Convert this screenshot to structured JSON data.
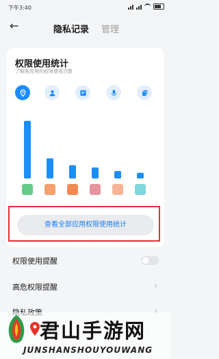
{
  "status": {
    "time": "下午3:40"
  },
  "header": {
    "back_icon": "arrow-left-icon",
    "tab_privacy": "隐私记录",
    "tab_manage": "管理"
  },
  "stats": {
    "title": "权限使用统计",
    "subtitle": "了解各应用的权限使用次数",
    "icons": [
      {
        "name": "location-icon",
        "active": true
      },
      {
        "name": "contacts-icon",
        "active": false
      },
      {
        "name": "sms-icon",
        "active": false
      },
      {
        "name": "microphone-icon",
        "active": false
      },
      {
        "name": "copy-icon",
        "active": false
      }
    ],
    "accent": "#1a8cff",
    "bar_color": "#1e8ef7",
    "view_all_button": "查看全部应用权限使用统计"
  },
  "chart_data": {
    "type": "bar",
    "categories": [
      "",
      "",
      "",
      "",
      "",
      ""
    ],
    "values": [
      100,
      35,
      23,
      19,
      13,
      10
    ],
    "app_icon_colors": [
      "#3bbf6a",
      "#f08a4b",
      "#f06a2a",
      "#e07a88",
      "#f3a27c",
      "#62cdd6"
    ]
  },
  "settings": {
    "permission_reminder": "权限使用提醒",
    "high_risk_reminder": "高危权限提醒",
    "privacy_policy": "隐私政策"
  },
  "watermark": {
    "title": "君山手游网",
    "subtitle": "JUNSHANSHOUYOUWANG"
  }
}
